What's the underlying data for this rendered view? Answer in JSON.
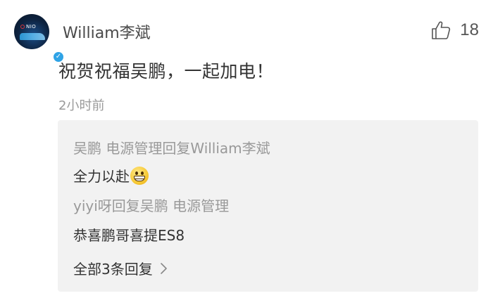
{
  "comment": {
    "user": "William李斌",
    "text": "祝贺祝福吴鹏，一起加电！",
    "time": "2小时前",
    "likes": "18",
    "avatar_logo": "NIO"
  },
  "replies": [
    {
      "meta": "吴鹏 电源管理回复William李斌",
      "text": "全力以赴"
    },
    {
      "meta": "yiyi呀回复吴鹏 电源管理",
      "text": "恭喜鹏哥喜提ES8"
    }
  ],
  "view_all": "全部3条回复",
  "icons": {
    "like": "thumbs-up-icon",
    "verified": "verified-badge-icon",
    "emoji": "grinning-emoji",
    "more": "chevron-right-icon"
  },
  "colors": {
    "verified_badge": "#2fa3e6",
    "reply_box_bg": "#f2f2f2",
    "meta_text": "#999999"
  }
}
